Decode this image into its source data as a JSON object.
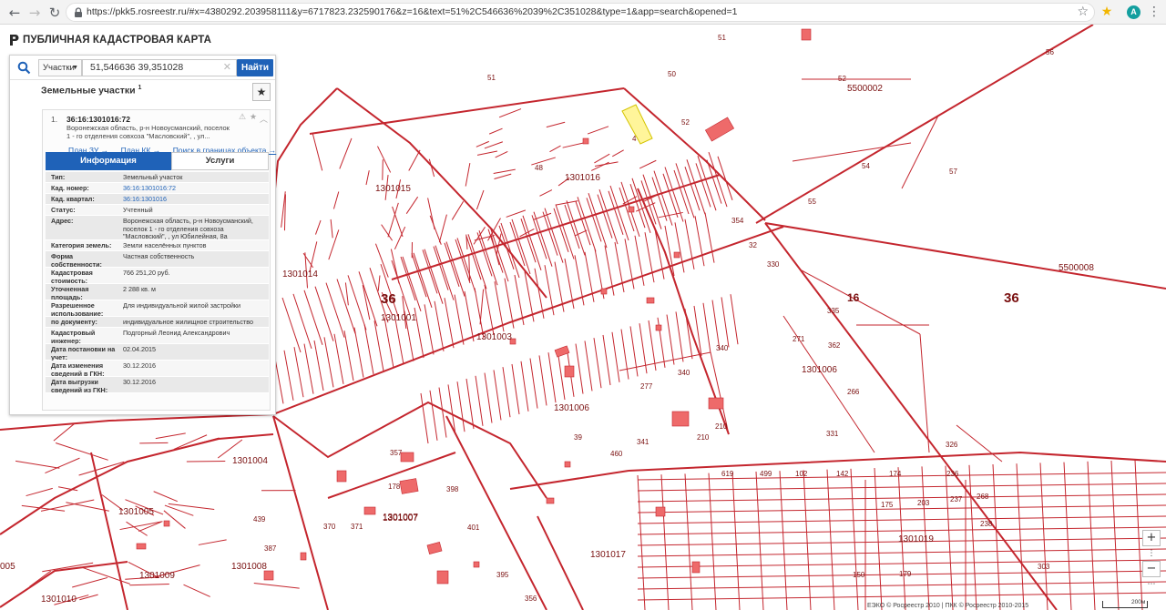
{
  "browser": {
    "url": "https://pkk5.rosreestr.ru/#x=4380292.203958111&y=6717823.232590176&z=16&text=51%2C546636%2039%2C351028&type=1&app=search&opened=1",
    "avatar_letter": "A"
  },
  "header": {
    "title": "ПУБЛИЧНАЯ КАДАСТРОВАЯ КАРТА"
  },
  "search": {
    "type_label": "Участки",
    "query": "51,546636 39,351028",
    "find_label": "Найти"
  },
  "results": {
    "section_title": "Земельные участки",
    "count": "1",
    "item": {
      "number": "1.",
      "cadastral": "36:16:1301016:72",
      "address_lines": [
        "Воронежская область, р-н Новоусманский, поселок",
        "1 - го отделения совхоза \"Масловский\", , ул..."
      ],
      "links": [
        "План ЗУ →",
        "План КК →",
        "Поиск в границах объекта →"
      ]
    },
    "tabs": {
      "info": "Информация",
      "services": "Услуги"
    },
    "rows": [
      {
        "key": "Тип:",
        "value": "Земельный участок"
      },
      {
        "key": "Кад. номер:",
        "value": "36:16:1301016:72"
      },
      {
        "key": "Кад. квартал:",
        "value": "36:16:1301016"
      },
      {
        "key": "Статус:",
        "value": "Учтенный"
      },
      {
        "key": "Адрес:",
        "value": "Воронежская область, р-н Новоусманский, поселок 1 - го отделения совхоза \"Масловский\", , ул Юбилейная, 8а"
      },
      {
        "key": "Категория земель:",
        "value": "Земли населённых пунктов"
      },
      {
        "key": "Форма собственности:",
        "value": "Частная собственность"
      },
      {
        "key": "Кадастровая стоимость:",
        "value": "766 251,20 руб."
      },
      {
        "key": "Уточненная площадь:",
        "value": "2 288 кв. м"
      },
      {
        "key": "Разрешенное использование:",
        "value": "Для индивидуальной жилой застройки"
      },
      {
        "key": "по документу:",
        "value": "индивидуальное жилищное строительство"
      },
      {
        "key": "Кадастровый инженер:",
        "value": "Подгорный Леонид Александрович"
      },
      {
        "key": "Дата постановки на учет:",
        "value": "02.04.2015"
      },
      {
        "key": "Дата изменения сведений в ГКН:",
        "value": "30.12.2016"
      },
      {
        "key": "Дата выгрузки сведений из ГКН:",
        "value": "30.12.2016"
      }
    ]
  },
  "map": {
    "district_labels": [
      "36",
      "16",
      "36"
    ],
    "zone_labels": [
      "5500002",
      "5500008"
    ],
    "quarter_labels": [
      "1301016",
      "1301015",
      "1301014",
      "1301001",
      "1301003",
      "1301006",
      "1301006",
      "1301004",
      "1301005",
      "1301007",
      "1301008",
      "1301009",
      "1301017",
      "1301019",
      "1301010",
      "1301007",
      "005"
    ],
    "parcel_labels": [
      "51",
      "50",
      "51",
      "52",
      "52",
      "54",
      "57",
      "55",
      "56",
      "340",
      "340",
      "271",
      "277",
      "210",
      "210",
      "331",
      "326",
      "266",
      "335",
      "362",
      "341",
      "619",
      "499",
      "102",
      "142",
      "174",
      "236",
      "175",
      "203",
      "237",
      "238",
      "398",
      "401",
      "395",
      "356",
      "387",
      "439",
      "371",
      "370",
      "178",
      "357",
      "4",
      "32",
      "330",
      "354",
      "48",
      "39",
      "460",
      "150",
      "179",
      "303",
      "268"
    ],
    "copyright": "ЕЭКО © Росреестр 2010 | ПКК © Росреестр 2010-2015",
    "scale": "200м"
  },
  "zoom": {
    "in": "+",
    "out": "−"
  }
}
